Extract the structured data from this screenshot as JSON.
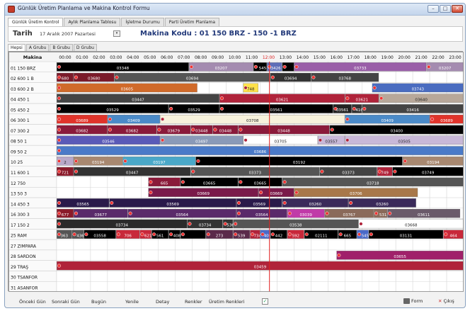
{
  "window": {
    "title": "Günlük Üretim Planlama ve Makina Kontrol Formu"
  },
  "main_tabs": [
    "Günlük Üretim Kontrol",
    "Aylık Planlama Tablosu",
    "İşletme Durumu",
    "Parti Üretim Planlama"
  ],
  "date_bar": {
    "label": "Tarih",
    "value": "17  Aralık  2007 Pazartesi",
    "machine_code": "Makina Kodu : 01 150 BRZ - 150 -1 BRZ"
  },
  "sub_tabs": [
    "Hepsi",
    "A Grubu",
    "B Grubu",
    "D Grubu"
  ],
  "grid": {
    "header_label": "Makina",
    "hours": [
      "00:00",
      "01:00",
      "02:00",
      "03:00",
      "04:00",
      "05:00",
      "06:00",
      "07:00",
      "08:00",
      "09:00",
      "10:00",
      "11:00",
      "12:00",
      "13:00",
      "14:00",
      "15:00",
      "16:00",
      "17:00",
      "18:00",
      "19:00",
      "20:00",
      "21:00",
      "22:00",
      "23:00"
    ],
    "current_hour": 12,
    "rows": [
      {
        "machine": "01 150 BRZ",
        "jobs": [
          [
            0,
            7.8,
            "#000",
            "03348"
          ],
          [
            7.8,
            11.6,
            "#a48bb0",
            "03207"
          ],
          [
            11.6,
            12.4,
            "#000",
            "545"
          ],
          [
            12.4,
            13.3,
            "#5e6eb8",
            "03426"
          ],
          [
            13.3,
            14.0,
            "#000",
            ""
          ],
          [
            14.0,
            21.8,
            "#9a5ea8",
            "03733"
          ],
          [
            21.8,
            24,
            "#a48bb0",
            "03207"
          ]
        ]
      },
      {
        "machine": "02 600 1 B",
        "jobs": [
          [
            0,
            1.0,
            "#7a1a2a",
            "680"
          ],
          [
            1.0,
            3.4,
            "#7a1a2a",
            "03680"
          ],
          [
            3.4,
            12.6,
            "#555",
            "03694"
          ],
          [
            12.6,
            15.0,
            "#333",
            "03694"
          ],
          [
            15.0,
            19.0,
            "#444",
            "03768"
          ]
        ]
      },
      {
        "machine": "03 600 2 B",
        "jobs": [
          [
            0,
            8.3,
            "#d06a2a",
            "03605"
          ],
          [
            11.0,
            11.9,
            "#ffe14a",
            "748"
          ],
          [
            18.6,
            24,
            "#4a6cc0",
            "03743"
          ]
        ]
      },
      {
        "machine": "04 450 1",
        "jobs": [
          [
            0,
            9.6,
            "#444",
            "03447"
          ],
          [
            9.6,
            17.0,
            "#b0233a",
            "03621"
          ],
          [
            17.0,
            19.0,
            "#b0233a",
            "03621"
          ],
          [
            19.0,
            24,
            "#b8a89a",
            "03640"
          ]
        ]
      },
      {
        "machine": "05 450 2",
        "jobs": [
          [
            0,
            6.6,
            "#000",
            "03529"
          ],
          [
            6.6,
            9.6,
            "#000",
            "03529"
          ],
          [
            9.6,
            16.3,
            "#000",
            "03561"
          ],
          [
            16.3,
            17.4,
            "#222",
            "03561"
          ],
          [
            17.4,
            18.0,
            "#333",
            "416"
          ],
          [
            18.0,
            24,
            "#444",
            "03416"
          ]
        ]
      },
      {
        "machine": "06 300 1",
        "jobs": [
          [
            0,
            3.0,
            "#e0332a",
            "03689"
          ],
          [
            3.0,
            6.1,
            "#4a8ac8",
            "03409"
          ],
          [
            6.1,
            17.0,
            "#f7f2dc",
            "03708"
          ],
          [
            17.0,
            22.0,
            "#4a8ac8",
            "03409"
          ],
          [
            22.0,
            24,
            "#e0332a",
            "03689"
          ]
        ]
      },
      {
        "machine": "07 300 2",
        "jobs": [
          [
            0,
            3.0,
            "#8a1a3a",
            "03682"
          ],
          [
            3.0,
            5.9,
            "#8a1a3a",
            "03682"
          ],
          [
            5.9,
            7.9,
            "#8a1a3a",
            "03679"
          ],
          [
            7.9,
            9.2,
            "#8a1a3a",
            "03448"
          ],
          [
            9.2,
            10.7,
            "#8a1a3a",
            "03448"
          ],
          [
            10.7,
            16.1,
            "#8a1a3a",
            "03448"
          ],
          [
            16.1,
            24,
            "#000",
            "03400"
          ]
        ]
      },
      {
        "machine": "08 50 1",
        "jobs": [
          [
            0,
            6.1,
            "#5a5ab8",
            "03546"
          ],
          [
            6.1,
            11.0,
            "#8a9ab8",
            "03497"
          ],
          [
            11.0,
            15.4,
            "#fff",
            "03705"
          ],
          [
            15.4,
            17.0,
            "#c8b8d8",
            "03557"
          ],
          [
            17.0,
            24,
            "#c8b8d8",
            "03505"
          ]
        ]
      },
      {
        "machine": "09 50 2",
        "jobs": [
          [
            0,
            24,
            "#4a7ac8",
            "03686"
          ]
        ]
      },
      {
        "machine": "10 25",
        "jobs": [
          [
            0,
            1.0,
            "#b8a8c8",
            "2"
          ],
          [
            1.0,
            3.9,
            "#a88870",
            "03194"
          ],
          [
            3.9,
            8.2,
            "#4aa8c8",
            "03197"
          ],
          [
            8.2,
            20.4,
            "#000",
            "03192"
          ],
          [
            20.4,
            24,
            "#a88870",
            "03194"
          ]
        ]
      },
      {
        "machine": "11 600 1",
        "jobs": [
          [
            0,
            1.0,
            "#8a1a2a",
            "721"
          ],
          [
            1.0,
            7.9,
            "#333",
            "03447"
          ],
          [
            7.9,
            15.5,
            "#555",
            "03373"
          ],
          [
            15.5,
            18.9,
            "#444",
            "03373"
          ],
          [
            18.9,
            19.8,
            "#b0233a",
            "749"
          ],
          [
            19.8,
            24,
            "#000",
            "03749"
          ]
        ]
      },
      {
        "machine": "12 750",
        "jobs": [
          [
            5.4,
            7.3,
            "#8a1a3a",
            "665"
          ],
          [
            7.3,
            10.7,
            "#000",
            "03665"
          ],
          [
            10.7,
            13.3,
            "#000",
            "03665"
          ],
          [
            13.3,
            24,
            "#555",
            "03718"
          ]
        ]
      },
      {
        "machine": "13 50 3",
        "jobs": [
          [
            5.4,
            11.9,
            "#7a1a4a",
            "03669"
          ],
          [
            11.9,
            14.0,
            "#7a1a4a",
            "03669"
          ],
          [
            14.0,
            21.3,
            "#a8784a",
            "03706"
          ]
        ]
      },
      {
        "machine": "14 450 3",
        "jobs": [
          [
            0,
            3.1,
            "#2a1a4a",
            "03565"
          ],
          [
            3.1,
            10.6,
            "#2a1a4a",
            "03569"
          ],
          [
            10.6,
            13.3,
            "#2a1a4a",
            "03569"
          ],
          [
            13.3,
            17.2,
            "#3a2a5a",
            "03260"
          ],
          [
            17.2,
            21.2,
            "#3a2a5a",
            "03260"
          ]
        ]
      },
      {
        "machine": "16 300 3",
        "jobs": [
          [
            0,
            1.0,
            "#8a1a2a",
            "677"
          ],
          [
            1.0,
            4.2,
            "#5a2a6a",
            "03677"
          ],
          [
            4.2,
            10.6,
            "#5a2a6a",
            "03564"
          ],
          [
            10.6,
            13.6,
            "#5a2a6a",
            "03564"
          ],
          [
            13.6,
            15.8,
            "#c03aa8",
            "03039"
          ],
          [
            15.8,
            18.7,
            "#8a6a5a",
            "03767"
          ],
          [
            18.7,
            19.5,
            "#8a6a5a",
            "531"
          ],
          [
            19.5,
            23.8,
            "#6a5a6a",
            "03611"
          ]
        ]
      },
      {
        "machine": "17 150 2",
        "jobs": [
          [
            0,
            0.9,
            "#a8b89a",
            "230"
          ],
          [
            0,
            7.7,
            "#2a2a2a",
            "03734"
          ],
          [
            7.7,
            9.8,
            "#333",
            "03734"
          ],
          [
            9.8,
            10.4,
            "#333",
            "536"
          ],
          [
            10.4,
            17.8,
            "#555",
            "03538"
          ],
          [
            17.8,
            24,
            "#fff",
            "03668"
          ]
        ]
      },
      {
        "machine": "25 RAM",
        "jobs": [
          [
            0,
            0.9,
            "#555",
            "363"
          ],
          [
            0.9,
            1.6,
            "#555",
            "436"
          ],
          [
            1.6,
            3.5,
            "#000",
            "03558"
          ],
          [
            3.5,
            4.9,
            "#c8283a",
            "706"
          ],
          [
            4.9,
            5.6,
            "#c8283a",
            "621"
          ],
          [
            5.6,
            6.6,
            "#000",
            "561"
          ],
          [
            6.6,
            7.3,
            "#000",
            "408"
          ],
          [
            7.3,
            8.8,
            "#000",
            ""
          ],
          [
            8.8,
            10.4,
            "#5a2a4a",
            "273"
          ],
          [
            10.4,
            11.4,
            "#5a2a4a",
            "539"
          ],
          [
            11.4,
            12.0,
            "#b0233a",
            "734"
          ],
          [
            12.0,
            12.6,
            "#4a6ac8",
            "409"
          ],
          [
            12.6,
            13.6,
            "#000",
            "442"
          ],
          [
            13.6,
            14.6,
            "#c8283a",
            "592"
          ],
          [
            14.6,
            16.6,
            "#000",
            "02111"
          ],
          [
            16.6,
            17.7,
            "#000",
            "665"
          ],
          [
            17.7,
            18.4,
            "#4a6ac8",
            "545"
          ],
          [
            18.4,
            22.8,
            "#000",
            "03131"
          ],
          [
            22.8,
            24,
            "#c8283a",
            "464"
          ]
        ]
      },
      {
        "machine": "27 ZIMPARA",
        "jobs": []
      },
      {
        "machine": "28 SARDON",
        "jobs": [
          [
            16.5,
            24,
            "#a0206a",
            "03655"
          ]
        ]
      },
      {
        "machine": "29 TRAŞ",
        "jobs": [
          [
            0,
            24,
            "#b0233a",
            "03459"
          ]
        ]
      },
      {
        "machine": "30 TSANFOR",
        "jobs": []
      },
      {
        "machine": "31 ASANFOR",
        "jobs": []
      }
    ]
  },
  "footer": {
    "prev_day": "Önceki Gün",
    "next_day": "Sonraki Gün",
    "today": "Bugün",
    "refresh": "Yenile",
    "detail": "Detay",
    "colors": "Renkler",
    "production_colors": "Üretim Renkleri",
    "form": "Form",
    "exit": "Çıkış"
  }
}
